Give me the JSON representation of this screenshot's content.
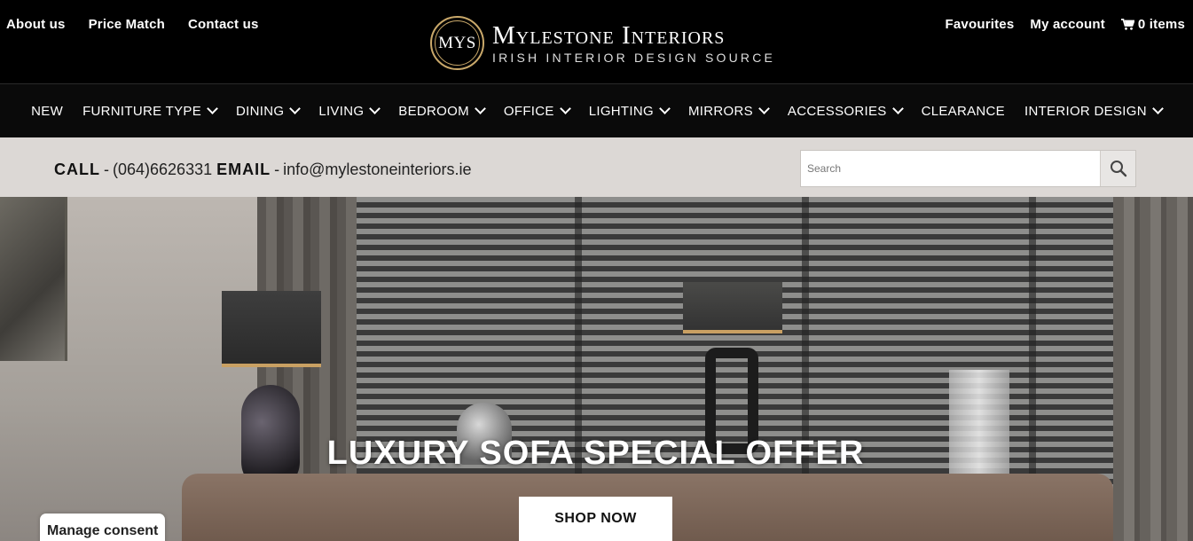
{
  "top_left_links": [
    "About us",
    "Price Match",
    "Contact us"
  ],
  "logo": {
    "badge": "MYS",
    "name": "Mylestone Interiors",
    "tagline": "IRISH INTERIOR DESIGN SOURCE"
  },
  "top_right": {
    "favourites": "Favourites",
    "account": "My account",
    "cart": "0 items"
  },
  "nav": [
    {
      "label": "NEW",
      "dropdown": false
    },
    {
      "label": "FURNITURE TYPE",
      "dropdown": true
    },
    {
      "label": "DINING",
      "dropdown": true
    },
    {
      "label": "LIVING",
      "dropdown": true
    },
    {
      "label": "BEDROOM",
      "dropdown": true
    },
    {
      "label": "OFFICE",
      "dropdown": true
    },
    {
      "label": "LIGHTING",
      "dropdown": true
    },
    {
      "label": "MIRRORS",
      "dropdown": true
    },
    {
      "label": "ACCESSORIES",
      "dropdown": true
    },
    {
      "label": "CLEARANCE",
      "dropdown": false
    },
    {
      "label": "INTERIOR DESIGN",
      "dropdown": true
    }
  ],
  "contact": {
    "call_label": "CALL",
    "phone": "(064)6626331",
    "email_label": "EMAIL",
    "email": "info@mylestoneinteriors.ie"
  },
  "search": {
    "placeholder": "Search"
  },
  "hero": {
    "title": "LUXURY SOFA SPECIAL OFFER",
    "button": "SHOP NOW"
  },
  "consent": {
    "label": "Manage consent"
  },
  "icons": {
    "cart": "cart-icon",
    "search": "search-icon",
    "dropdown": "chevron-down-icon"
  },
  "colors": {
    "header_bg": "#000000",
    "nav_bg": "#0a0a0a",
    "contact_bg": "#dcd8d5",
    "logo_gold": "#c9a86a"
  }
}
